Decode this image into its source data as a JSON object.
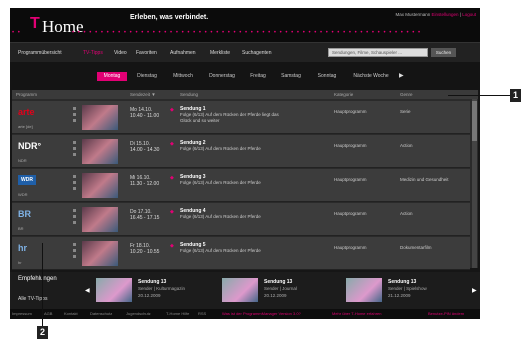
{
  "header": {
    "slogan": "Erleben, was verbindet.",
    "logo_t": "T",
    "logo_home": "Home",
    "dots_left": "• •",
    "dots_right": "• • • • • • • • • • • • • • • • • • • • • • • • • • • • • • • • • • • • • • • • • • • • • • • • • • • • • • • • • • • • •",
    "user": "Max Mustermann",
    "user_link1": "Einstellungen",
    "user_sep": "|",
    "user_link2": "Logout"
  },
  "nav": {
    "items": [
      "Programmübersicht",
      "TV-Tipps",
      "Video",
      "Favoriten",
      "Aufnahmen",
      "Merkliste",
      "Suchagenten"
    ],
    "search_placeholder": "Sendungen, Filme, Schauspieler ...",
    "search_button": "Suchen"
  },
  "days": {
    "items": [
      "Montag",
      "Dienstag",
      "Mittwoch",
      "Donnerstag",
      "Freitag",
      "Samstag",
      "Sonntag",
      "Nächste Woche"
    ],
    "arrow": "▶"
  },
  "columns": {
    "program": "Programm",
    "time": "Sendezeit ▼",
    "show": "Sendung",
    "category": "Kategorie",
    "genre": "Genre"
  },
  "rows": [
    {
      "logo": "arte",
      "channel": "arte [de]",
      "day_time": "Mo 14.10.",
      "time_range": "10.40 - 11.00",
      "title": "Sendung 1",
      "desc": "Folge (6/13) Auf dem Rücken der Pferde liegt das Glück und so weiter",
      "category": "Hauptprogramm",
      "genre": "Serie",
      "mark": "◆"
    },
    {
      "logo": "NDR°",
      "channel": "NDR",
      "day_time": "Di 15.10.",
      "time_range": "14.00 - 14.30",
      "title": "Sendung 2",
      "desc": "Folge (6/13) Auf dem Rücken der Pferde",
      "category": "Hauptprogramm",
      "genre": "Action",
      "mark": "◆"
    },
    {
      "logo": "WDR",
      "channel": "WDR",
      "day_time": "Mi 16.10.",
      "time_range": "11.30 - 12.00",
      "title": "Sendung 3",
      "desc": "Folge (6/13) Auf dem Rücken der Pferde",
      "category": "Hauptprogramm",
      "genre": "Medizin und Gesundheit",
      "mark": "◆"
    },
    {
      "logo": "BR",
      "channel": "BR",
      "day_time": "Do 17.10.",
      "time_range": "16.45 - 17.15",
      "title": "Sendung 4",
      "desc": "Folge (6/13) Auf dem Rücken der Pferde",
      "category": "Hauptprogramm",
      "genre": "Action",
      "mark": "◆"
    },
    {
      "logo": "hr",
      "channel": "hr",
      "day_time": "Fr 18.10.",
      "time_range": "10.20 - 10.55",
      "title": "Sendung 5",
      "desc": "Folge (6/13) Auf dem Rücken der Pferde",
      "category": "Hauptprogramm",
      "genre": "Dokumentarfilm",
      "mark": "◆"
    }
  ],
  "recommendations": {
    "label": "Empfehlungen",
    "all": "Alle TV-Tipps",
    "left": "◀",
    "right": "▶",
    "cards": [
      {
        "title": "Sendung 13",
        "meta": "Sender | Kulturmagazin",
        "date": "20.12.2009"
      },
      {
        "title": "Sendung 13",
        "meta": "Sender | Journal",
        "date": "20.12.2009"
      },
      {
        "title": "Sendung 13",
        "meta": "Sender | Spielshow",
        "date": "21.12.2009"
      }
    ]
  },
  "footer": {
    "items": [
      "Impressum",
      "AGB",
      "Kontakt",
      "Datenschutz",
      "Jugendschutz",
      "T-Home Hilfe",
      "RSS"
    ],
    "highlight": "Was ist der ProgrammManager Version 3.0?",
    "more": "Mehr über T-Home erfahren",
    "pin": "Benutze-PIN ändern"
  },
  "callouts": [
    "1",
    "2"
  ],
  "colors": {
    "magenta": "#e20074",
    "background": "#161616"
  }
}
